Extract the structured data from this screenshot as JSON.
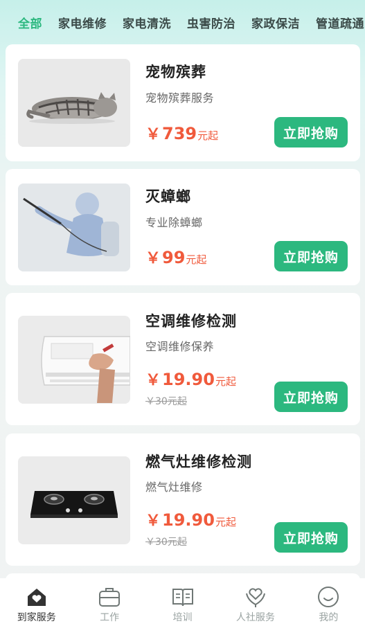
{
  "colors": {
    "accent": "#2cb87f",
    "price": "#f05a3c"
  },
  "tabs": [
    "全部",
    "家电维修",
    "家电清洗",
    "虫害防治",
    "家政保洁",
    "管道疏通"
  ],
  "cards": [
    {
      "title": "宠物殡葬",
      "subtitle": "宠物殡葬服务",
      "yen": "￥",
      "price": "739",
      "unit": "元起",
      "old_price": "",
      "button": "立即抢购",
      "image": "sleeping-cat"
    },
    {
      "title": "灭蟑螂",
      "subtitle": "专业除蟑螂",
      "yen": "￥",
      "price": "99",
      "unit": "元起",
      "old_price": "",
      "button": "立即抢购",
      "image": "pest-sprayer"
    },
    {
      "title": "空调维修检测",
      "subtitle": "空调维修保养",
      "yen": "￥",
      "price": "19.90",
      "unit": "元起",
      "old_price": "￥30元起",
      "button": "立即抢购",
      "image": "air-conditioner"
    },
    {
      "title": "燃气灶维修检测",
      "subtitle": "燃气灶维修",
      "yen": "￥",
      "price": "19.90",
      "unit": "元起",
      "old_price": "￥30元起",
      "button": "立即抢购",
      "image": "gas-stove"
    }
  ],
  "nav": [
    {
      "label": "到家服务",
      "icon": "home-heart-icon",
      "active": true
    },
    {
      "label": "工作",
      "icon": "briefcase-icon",
      "active": false
    },
    {
      "label": "培训",
      "icon": "book-icon",
      "active": false
    },
    {
      "label": "人社服务",
      "icon": "heart-hands-icon",
      "active": false
    },
    {
      "label": "我的",
      "icon": "smile-icon",
      "active": false
    }
  ]
}
